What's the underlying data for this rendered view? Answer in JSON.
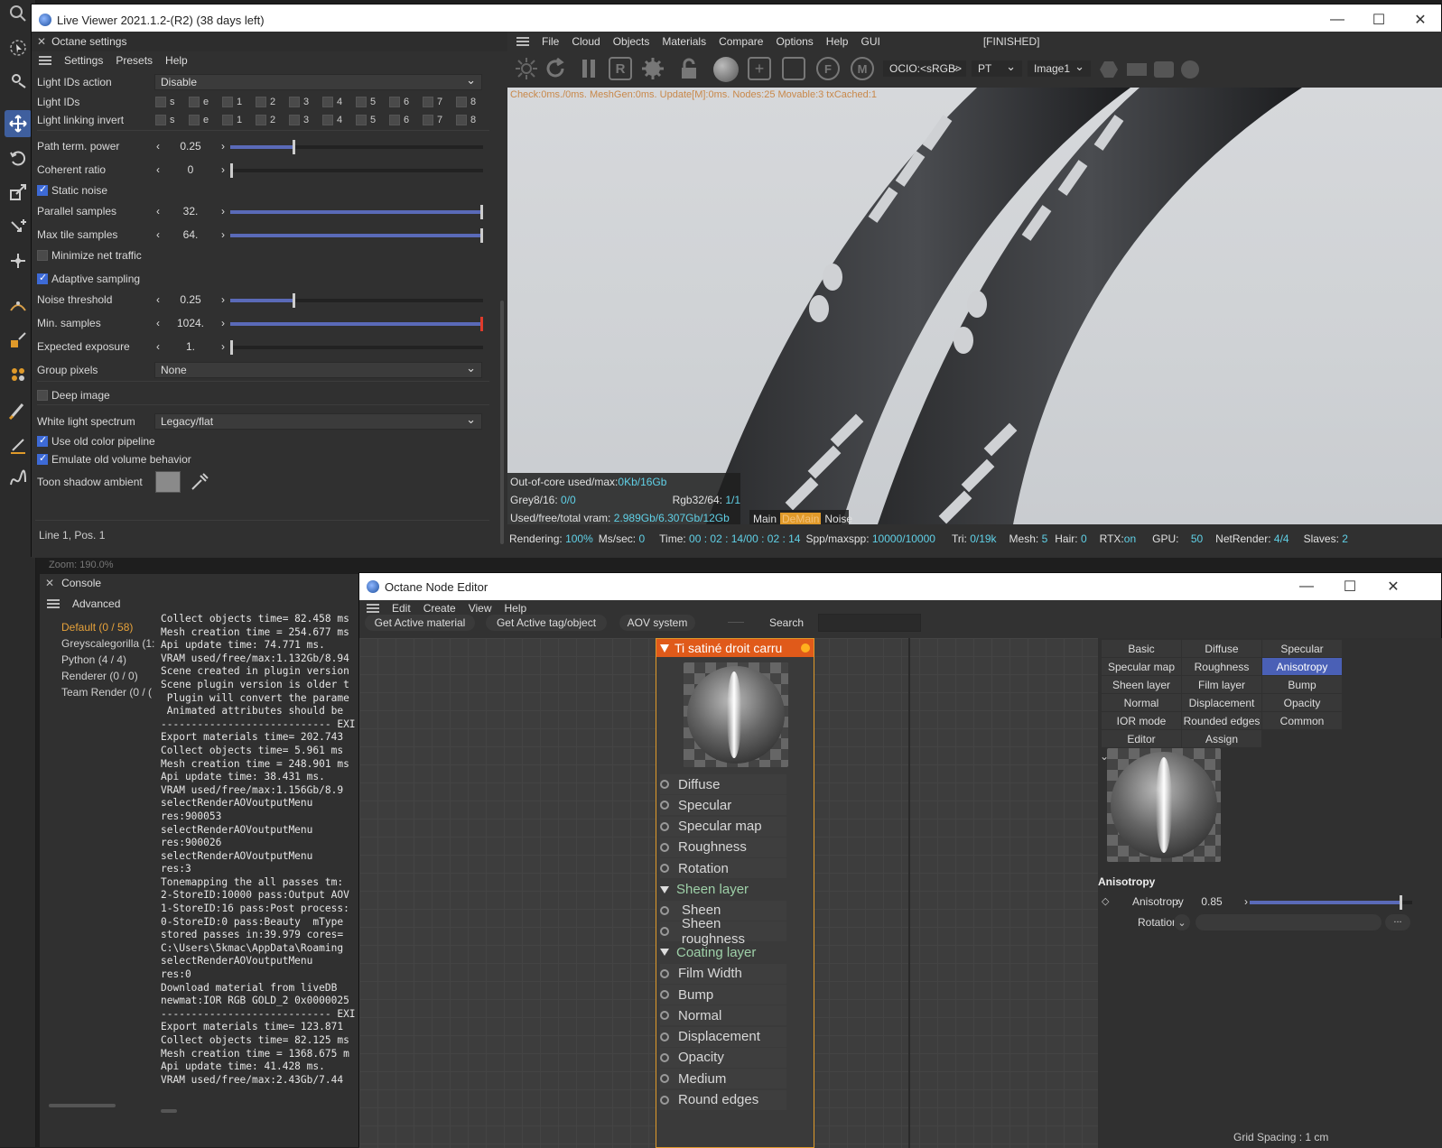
{
  "live_viewer": {
    "title": "Live Viewer 2021.1.2-(R2) (38 days left)",
    "menu": [
      "File",
      "Cloud",
      "Objects",
      "Materials",
      "Compare",
      "Options",
      "Help",
      "GUI"
    ],
    "status": "[FINISHED]",
    "ocio": "OCIO:<sRGB>",
    "kernel": "PT",
    "image": "Image1",
    "check_line": "Check:0ms./0ms. MeshGen:0ms. Update[M]:0ms. Nodes:25 Movable:3 txCached:1",
    "info": {
      "outofcore_label": "Out-of-core used/max:",
      "outofcore_val": "0Kb/16Gb",
      "grey_label": "Grey8/16:",
      "grey_val": "0/0",
      "rgb_label": "Rgb32/64:",
      "rgb_val": "1/1",
      "vram_label": "Used/free/total vram:",
      "vram_val": "2.989Gb/6.307Gb/12Gb"
    },
    "modes": [
      "Main",
      "DeMain",
      "Noise"
    ],
    "statusbar": {
      "rendering_label": "Rendering:",
      "rendering_val": "100%",
      "mssec_label": "Ms/sec:",
      "mssec_val": "0",
      "time_label": "Time:",
      "time_val": "00 : 02 : 14/00 : 02 : 14",
      "spp_label": "Spp/maxspp:",
      "spp_val": "10000/10000",
      "tri_label": "Tri:",
      "tri_val": "0/19k",
      "mesh_label": "Mesh:",
      "mesh_val": "5",
      "hair_label": "Hair:",
      "hair_val": "0",
      "rtx_label": "RTX:",
      "rtx_val": "on",
      "gpu_label": "GPU:",
      "gpu_val": "50",
      "net_label": "NetRender:",
      "net_val": "4/4",
      "slaves_label": "Slaves:",
      "slaves_val": "2"
    }
  },
  "settings": {
    "title": "Octane settings",
    "menu": [
      "Settings",
      "Presets",
      "Help"
    ],
    "light_ids_action_label": "Light IDs action",
    "light_ids_action_value": "Disable",
    "light_ids_label": "Light IDs",
    "light_link_label": "Light linking invert",
    "lid_items": [
      "s",
      "e",
      "1",
      "2",
      "3",
      "4",
      "5",
      "6",
      "7",
      "8"
    ],
    "path_term_label": "Path term. power",
    "path_term_value": "0.25",
    "path_term_frac": 0.25,
    "coherent_label": "Coherent ratio",
    "coherent_value": "0",
    "coherent_frac": 0,
    "static_noise_label": "Static noise",
    "parallel_label": "Parallel samples",
    "parallel_value": "32.",
    "parallel_frac": 1,
    "maxtile_label": "Max tile samples",
    "maxtile_value": "64.",
    "maxtile_frac": 1,
    "minnet_label": "Minimize net traffic",
    "adaptive_label": "Adaptive sampling",
    "noise_label": "Noise threshold",
    "noise_value": "0.25",
    "noise_frac": 0.25,
    "minsamples_label": "Min. samples",
    "minsamples_value": "1024.",
    "minsamples_frac": 1,
    "expexp_label": "Expected exposure",
    "expexp_value": "1.",
    "expexp_frac": 0,
    "group_label": "Group pixels",
    "group_value": "None",
    "deep_label": "Deep image",
    "wls_label": "White light spectrum",
    "wls_value": "Legacy/flat",
    "oldcolor_label": "Use old color pipeline",
    "oldvol_label": "Emulate old volume behavior",
    "toon_label": "Toon shadow ambient",
    "footer": "Line 1, Pos. 1",
    "zoom": "Zoom: 190.0%"
  },
  "console": {
    "title": "Console",
    "mode": "Advanced",
    "tree": [
      "Default (0 / 58)",
      "Greyscalegorilla (1:",
      "Python (4 / 4)",
      "Renderer (0 / 0)",
      "Team Render  (0 / ("
    ],
    "lines": [
      "Collect objects time= 82.458 ms",
      "Mesh creation time = 254.677 ms",
      "Api update time: 74.771 ms.",
      "VRAM used/free/max:1.132Gb/8.94",
      "Scene created in plugin version",
      "Scene plugin version is older t",
      " Plugin will convert the parame",
      " Animated attributes should be",
      "---------------------------- EXI",
      "Export materials time= 202.743",
      "Collect objects time= 5.961 ms",
      "Mesh creation time = 248.901 ms",
      "Api update time: 38.431 ms.",
      "VRAM used/free/max:1.156Gb/8.9",
      "selectRenderAOVoutputMenu",
      "res:900053",
      "selectRenderAOVoutputMenu",
      "res:900026",
      "selectRenderAOVoutputMenu",
      "res:3",
      "Tonemapping the all passes tm:",
      "2-StoreID:10000 pass:Output AOV",
      "1-StoreID:16 pass:Post process:",
      "0-StoreID:0 pass:Beauty  mType",
      "stored passes in:39.979 cores=",
      "C:\\Users\\5kmac\\AppData\\Roaming",
      "selectRenderAOVoutputMenu",
      "res:0",
      "Download material from liveDB",
      "newmat:IOR RGB GOLD_2 0x0000025",
      "---------------------------- EXI",
      "Export materials time= 123.871",
      "Collect objects time= 82.125 ms",
      "Mesh creation time = 1368.675 m",
      "Api update time: 41.428 ms.",
      "VRAM used/free/max:2.43Gb/7.44"
    ]
  },
  "node_editor": {
    "title": "Octane Node Editor",
    "menu": [
      "Edit",
      "Create",
      "View",
      "Help"
    ],
    "btn_active_material": "Get Active material",
    "btn_active_tag": "Get Active tag/object",
    "btn_aov": "AOV system",
    "search_label": "Search",
    "node_title": "Ti satiné droit carru",
    "pins": [
      {
        "label": "Diffuse",
        "group": false
      },
      {
        "label": "Specular",
        "group": false
      },
      {
        "label": "Specular map",
        "group": false
      },
      {
        "label": "Roughness",
        "group": false
      },
      {
        "label": "Rotation",
        "group": false
      },
      {
        "label": "Sheen layer",
        "group": true
      },
      {
        "label": "Sheen",
        "group": false
      },
      {
        "label": "Sheen roughness",
        "group": false
      },
      {
        "label": "Coating layer",
        "group": true
      },
      {
        "label": "Film Width",
        "group": false
      },
      {
        "label": "Bump",
        "group": false
      },
      {
        "label": "Normal",
        "group": false
      },
      {
        "label": "Displacement",
        "group": false
      },
      {
        "label": "Opacity",
        "group": false
      },
      {
        "label": "Medium",
        "group": false
      },
      {
        "label": "Round edges",
        "group": false
      }
    ],
    "tabs": [
      "Basic",
      "Diffuse",
      "Specular",
      "Specular map",
      "Roughness",
      "Anisotropy",
      "Sheen layer",
      "Film layer",
      "Bump",
      "Normal",
      "Displacement",
      "Opacity",
      "IOR mode",
      "Rounded edges",
      "Common",
      "Editor",
      "Assign"
    ],
    "active_tab": "Anisotropy",
    "section_title": "Anisotropy",
    "aniso_label": "Anisotropy",
    "aniso_value": "0.85",
    "aniso_frac": 0.925,
    "rotation_label": "Rotation",
    "rotation_more": "...",
    "grid_spacing": "Grid Spacing : 1 cm"
  },
  "colors": {
    "accent": "#3d6ad6",
    "node_border": "#e09a2a",
    "stat_value": "#60d0e6",
    "warn": "#c8884a"
  }
}
